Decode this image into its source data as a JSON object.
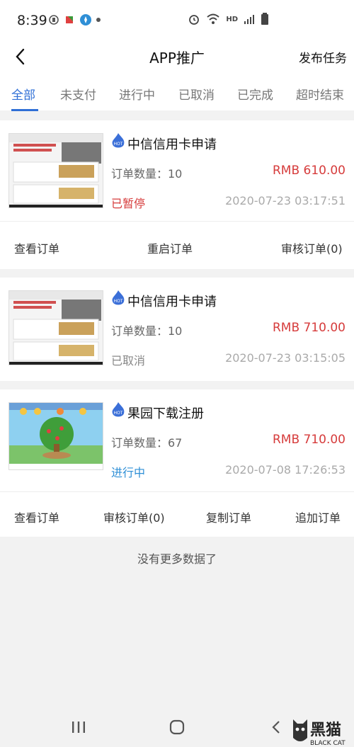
{
  "status_bar": {
    "time": "8:39"
  },
  "header": {
    "title": "APP推广",
    "publish_label": "发布任务"
  },
  "tabs": [
    {
      "label": "全部",
      "active": true
    },
    {
      "label": "未支付"
    },
    {
      "label": "进行中"
    },
    {
      "label": "已取消"
    },
    {
      "label": "已完成"
    },
    {
      "label": "超时结束"
    }
  ],
  "orders": [
    {
      "title": "中信信用卡申请",
      "qty_text": "订单数量：10",
      "price": "RMB  610.00",
      "status": "已暂停",
      "status_color": "#d63b3b",
      "date": "2020-07-23 03:17:51",
      "thumb_icon": "credit-card-ad-thumbnail",
      "actions": [
        "查看订单",
        "重启订单",
        "审核订单(0)"
      ]
    },
    {
      "title": "中信信用卡申请",
      "qty_text": "订单数量：10",
      "price": "RMB  710.00",
      "status": "已取消",
      "status_color": "#888888",
      "date": "2020-07-23 03:15:05",
      "thumb_icon": "credit-card-ad-thumbnail",
      "actions": []
    },
    {
      "title": "果园下载注册",
      "qty_text": "订单数量：67",
      "price": "RMB  710.00",
      "status": "进行中",
      "status_color": "#2f8fd6",
      "date": "2020-07-08 17:26:53",
      "thumb_icon": "orchard-game-thumbnail",
      "actions": [
        "查看订单",
        "审核订单(0)",
        "复制订单",
        "追加订单"
      ]
    }
  ],
  "footer": {
    "no_more": "没有更多数据了"
  },
  "watermark": {
    "text": "黑猫",
    "subtext": "BLACK CAT"
  },
  "colors": {
    "accent": "#2f6fd6",
    "price": "#d63b3b"
  }
}
